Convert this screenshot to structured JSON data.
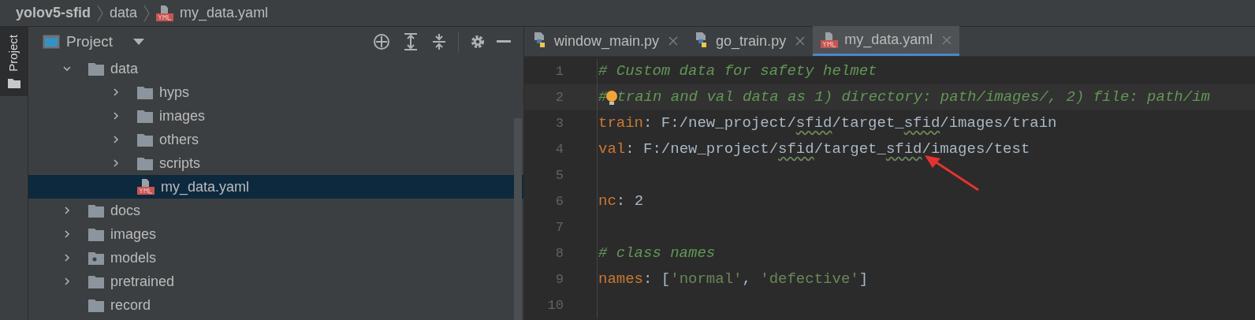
{
  "breadcrumbs": [
    {
      "label": "yolov5-sfid",
      "kind": "project"
    },
    {
      "label": "data",
      "kind": "folder"
    },
    {
      "label": "my_data.yaml",
      "kind": "yaml"
    }
  ],
  "side_strip": {
    "label": "Project"
  },
  "project_panel": {
    "title": "Project",
    "tree": [
      {
        "label": "data",
        "kind": "folder",
        "expanded": true,
        "children": [
          {
            "label": "hyps",
            "kind": "folder",
            "expanded": false,
            "selected": false
          },
          {
            "label": "images",
            "kind": "folder",
            "expanded": false,
            "selected": false
          },
          {
            "label": "others",
            "kind": "folder",
            "expanded": false,
            "selected": false
          },
          {
            "label": "scripts",
            "kind": "folder",
            "expanded": false,
            "selected": false
          },
          {
            "label": "my_data.yaml",
            "kind": "yaml",
            "selected": true
          }
        ],
        "selected": false
      },
      {
        "label": "docs",
        "kind": "folder",
        "expanded": false,
        "selected": false
      },
      {
        "label": "images",
        "kind": "folder",
        "expanded": false,
        "selected": false
      },
      {
        "label": "models",
        "kind": "package",
        "expanded": false,
        "selected": false
      },
      {
        "label": "pretrained",
        "kind": "folder",
        "expanded": false,
        "selected": false
      },
      {
        "label": "record",
        "kind": "plain-folder",
        "selected": false
      }
    ]
  },
  "tabs": [
    {
      "label": "window_main.py",
      "kind": "python",
      "selected": false
    },
    {
      "label": "go_train.py",
      "kind": "python",
      "selected": false
    },
    {
      "label": "my_data.yaml",
      "kind": "yaml",
      "selected": true
    }
  ],
  "editor": {
    "lines": [
      {
        "number": "1",
        "tokens": [
          {
            "kind": "comment",
            "text": "# Custom data for safety helmet"
          }
        ]
      },
      {
        "number": "2",
        "bulb": true,
        "tokens": [
          {
            "kind": "comment",
            "text": "#"
          },
          {
            "kind": "comment",
            "text": "train and val data as 1) directory: path/images/, 2) file: path/im"
          }
        ]
      },
      {
        "number": "3",
        "tokens": [
          {
            "kind": "key",
            "text": "train"
          },
          {
            "kind": "plain",
            "text": ": F:/new_project/"
          },
          {
            "kind": "typo",
            "text": "sfid"
          },
          {
            "kind": "plain",
            "text": "/target_"
          },
          {
            "kind": "typo",
            "text": "sfid"
          },
          {
            "kind": "plain",
            "text": "/images/train"
          }
        ]
      },
      {
        "number": "4",
        "tokens": [
          {
            "kind": "key",
            "text": "val"
          },
          {
            "kind": "plain",
            "text": ": F:/new_project/"
          },
          {
            "kind": "typo",
            "text": "sfid"
          },
          {
            "kind": "plain",
            "text": "/target_"
          },
          {
            "kind": "typo",
            "text": "sfid"
          },
          {
            "kind": "plain",
            "text": "/images/test"
          }
        ]
      },
      {
        "number": "5"
      },
      {
        "number": "6",
        "tokens": [
          {
            "kind": "key",
            "text": "nc"
          },
          {
            "kind": "plain",
            "text": ": "
          },
          {
            "kind": "number",
            "text": "2"
          }
        ]
      },
      {
        "number": "7"
      },
      {
        "number": "8",
        "tokens": [
          {
            "kind": "comment",
            "text": "# class names"
          }
        ]
      },
      {
        "number": "9",
        "tokens": [
          {
            "kind": "key",
            "text": "names"
          },
          {
            "kind": "plain",
            "text": ": ["
          },
          {
            "kind": "string",
            "text": "'normal'"
          },
          {
            "kind": "plain",
            "text": ", "
          },
          {
            "kind": "string",
            "text": "'defective'"
          },
          {
            "kind": "plain",
            "text": "]"
          }
        ]
      },
      {
        "number": "10"
      }
    ]
  }
}
